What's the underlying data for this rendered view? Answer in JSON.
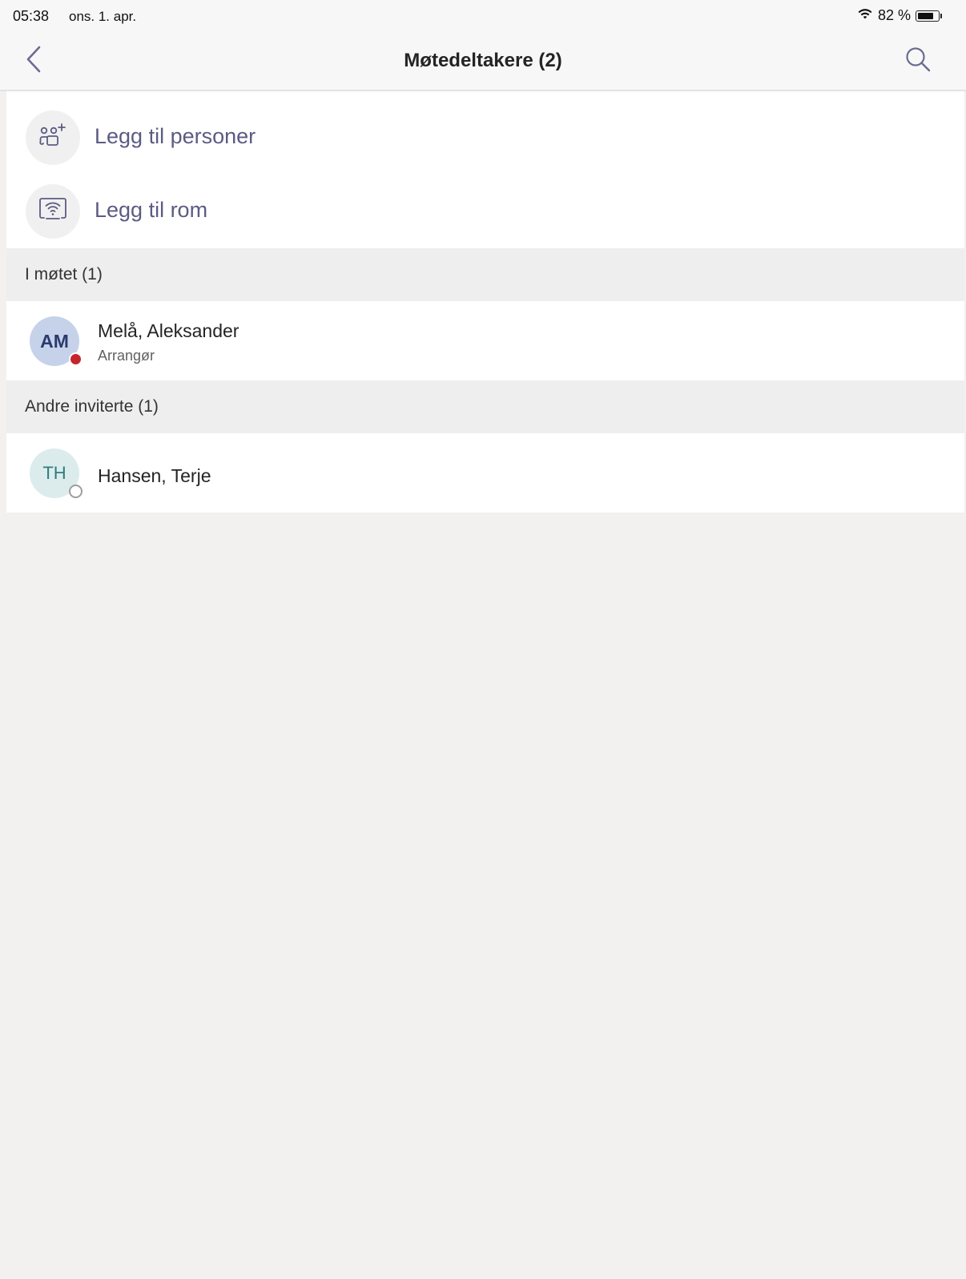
{
  "status_bar": {
    "time": "05:38",
    "date": "ons. 1. apr.",
    "battery": "82 %",
    "battery_level": 0.82,
    "wifi_icon": "wifi-icon"
  },
  "nav": {
    "title": "Møtedeltakere (2)",
    "back_icon": "chevron-left-icon",
    "search_icon": "search-icon"
  },
  "actions": [
    {
      "label": "Legg til personer",
      "icon": "add-people-icon"
    },
    {
      "label": "Legg til rom",
      "icon": "room-cast-icon"
    }
  ],
  "sections": {
    "in_meeting": {
      "header": "I møtet (1)",
      "participants": [
        {
          "initials": "AM",
          "name": "Melå, Aleksander",
          "role": "Arrangør",
          "presence": "busy"
        }
      ]
    },
    "other_invited": {
      "header": "Andre inviterte (1)",
      "participants": [
        {
          "initials": "TH",
          "name": "Hansen, Terje",
          "role": "",
          "presence": "offline"
        }
      ]
    }
  },
  "colors": {
    "accent": "#5b5b84",
    "busy": "#c4262e",
    "avatar_am_bg": "#c6d2ea",
    "avatar_th_bg": "#dcecec"
  }
}
